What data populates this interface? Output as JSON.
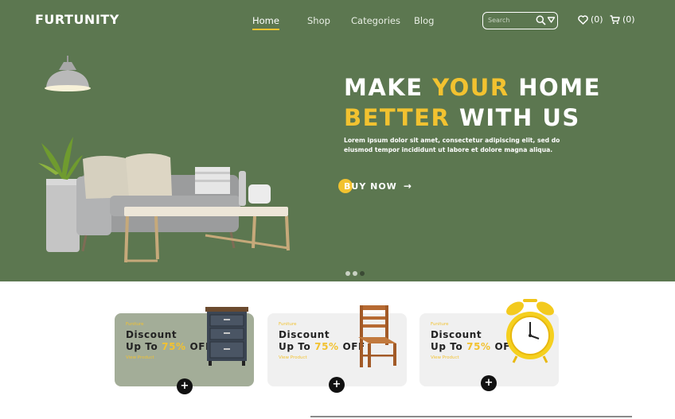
{
  "brand": {
    "logo": "FURTUNITY"
  },
  "nav": {
    "links": [
      "Home",
      "Shop",
      "Categories",
      "Blog"
    ],
    "search_placeholder": "Search",
    "wishlist_count": "(0)",
    "cart_count": "(0)"
  },
  "hero": {
    "title_line1_a": "MAKE ",
    "title_line1_b": "YOUR",
    "title_line1_c": " HOME",
    "title_line2_a": "BETTER",
    "title_line2_b": " WITH US",
    "description": "Lorem ipsum dolor sit amet, consectetur adipiscing elit, sed do eiusmod tempor incididunt ut labore et dolore magna aliqua.",
    "cta": "BUY NOW"
  },
  "slider": {
    "total": 3,
    "active_index": 2
  },
  "cards": [
    {
      "kicker": "Funiture",
      "line1": "Discount",
      "line2_prefix": "Up To ",
      "percent": "75%",
      "line2_suffix": " OFF",
      "link": "View Product",
      "plus": "+"
    },
    {
      "kicker": "Funiture",
      "line1": "Discount",
      "line2_prefix": "Up To ",
      "percent": "75%",
      "line2_suffix": " OFF",
      "link": "View Product",
      "plus": "+"
    },
    {
      "kicker": "Funiture",
      "line1": "Discount",
      "line2_prefix": "Up To ",
      "percent": "75%",
      "line2_suffix": " OFF",
      "link": "View Product",
      "plus": "+"
    }
  ],
  "colors": {
    "hero_bg": "#5c7750",
    "accent": "#f2c230",
    "card_green": "#a3ad98",
    "card_gray": "#f0f0f0"
  }
}
